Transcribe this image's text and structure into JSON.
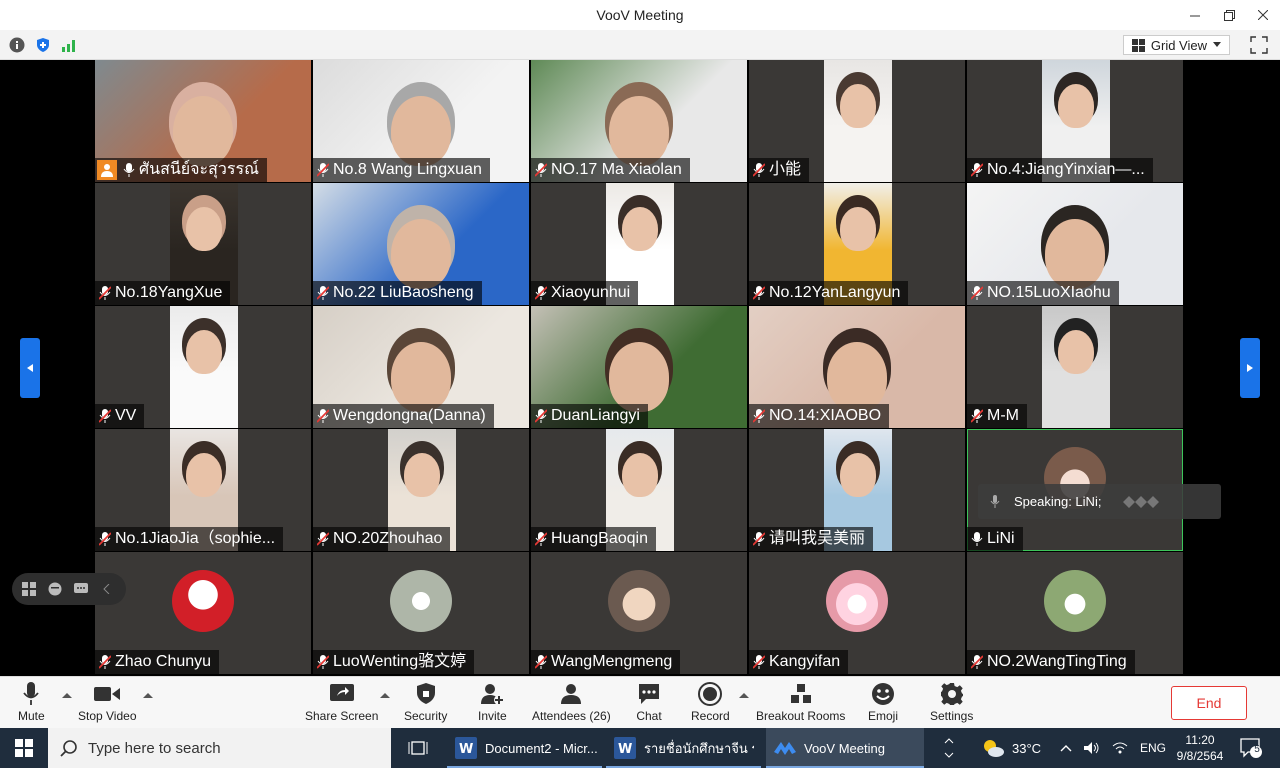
{
  "window": {
    "title": "VooV Meeting",
    "view_label": "Grid View"
  },
  "participants": [
    {
      "name": "ศันสนีย์จะสุวรรณ์",
      "host": true
    },
    {
      "name": "No.8 Wang Lingxuan"
    },
    {
      "name": "NO.17 Ma Xiaolan"
    },
    {
      "name": "小能"
    },
    {
      "name": "No.4:JiangYinxian—..."
    },
    {
      "name": "No.18YangXue"
    },
    {
      "name": "No.22 LiuBaosheng"
    },
    {
      "name": "Xiaoyunhui"
    },
    {
      "name": "No.12YanLangyun"
    },
    {
      "name": "NO.15LuoXIaohu"
    },
    {
      "name": "VV"
    },
    {
      "name": "Wengdongna(Danna)"
    },
    {
      "name": "DuanLiangyi"
    },
    {
      "name": "NO.14:XIAOBO"
    },
    {
      "name": "M-M"
    },
    {
      "name": "No.1JiaoJia（sophie..."
    },
    {
      "name": "NO.20Zhouhao"
    },
    {
      "name": "HuangBaoqin"
    },
    {
      "name": "请叫我吴美丽"
    },
    {
      "name": "LiNi",
      "active": true
    },
    {
      "name": "Zhao Chunyu"
    },
    {
      "name": "LuoWenting骆文婷"
    },
    {
      "name": "WangMengmeng"
    },
    {
      "name": "Kangyifan"
    },
    {
      "name": "NO.2WangTingTing"
    }
  ],
  "speaking": {
    "text": "Speaking: LiNi;"
  },
  "controls": {
    "mute": "Mute",
    "stop_video": "Stop Video",
    "share_screen": "Share Screen",
    "security": "Security",
    "invite": "Invite",
    "attendees": "Attendees (26)",
    "chat": "Chat",
    "record": "Record",
    "breakout": "Breakout Rooms",
    "emoji": "Emoji",
    "settings": "Settings",
    "end": "End"
  },
  "taskbar": {
    "search_placeholder": "Type here to search",
    "apps": [
      {
        "label": "Document2 - Micr..."
      },
      {
        "label": "รายชื่อนักศึกษาจีน รุ่น ..."
      },
      {
        "label": "VooV Meeting"
      }
    ],
    "weather": "33°C",
    "lang": "ENG",
    "time": "11:20",
    "date": "9/8/2564",
    "notifications": "5"
  },
  "colors": {
    "accent": "#1a73e8",
    "end": "#e53935",
    "active_border": "#3dc45a",
    "host_badge": "#f08a24"
  }
}
